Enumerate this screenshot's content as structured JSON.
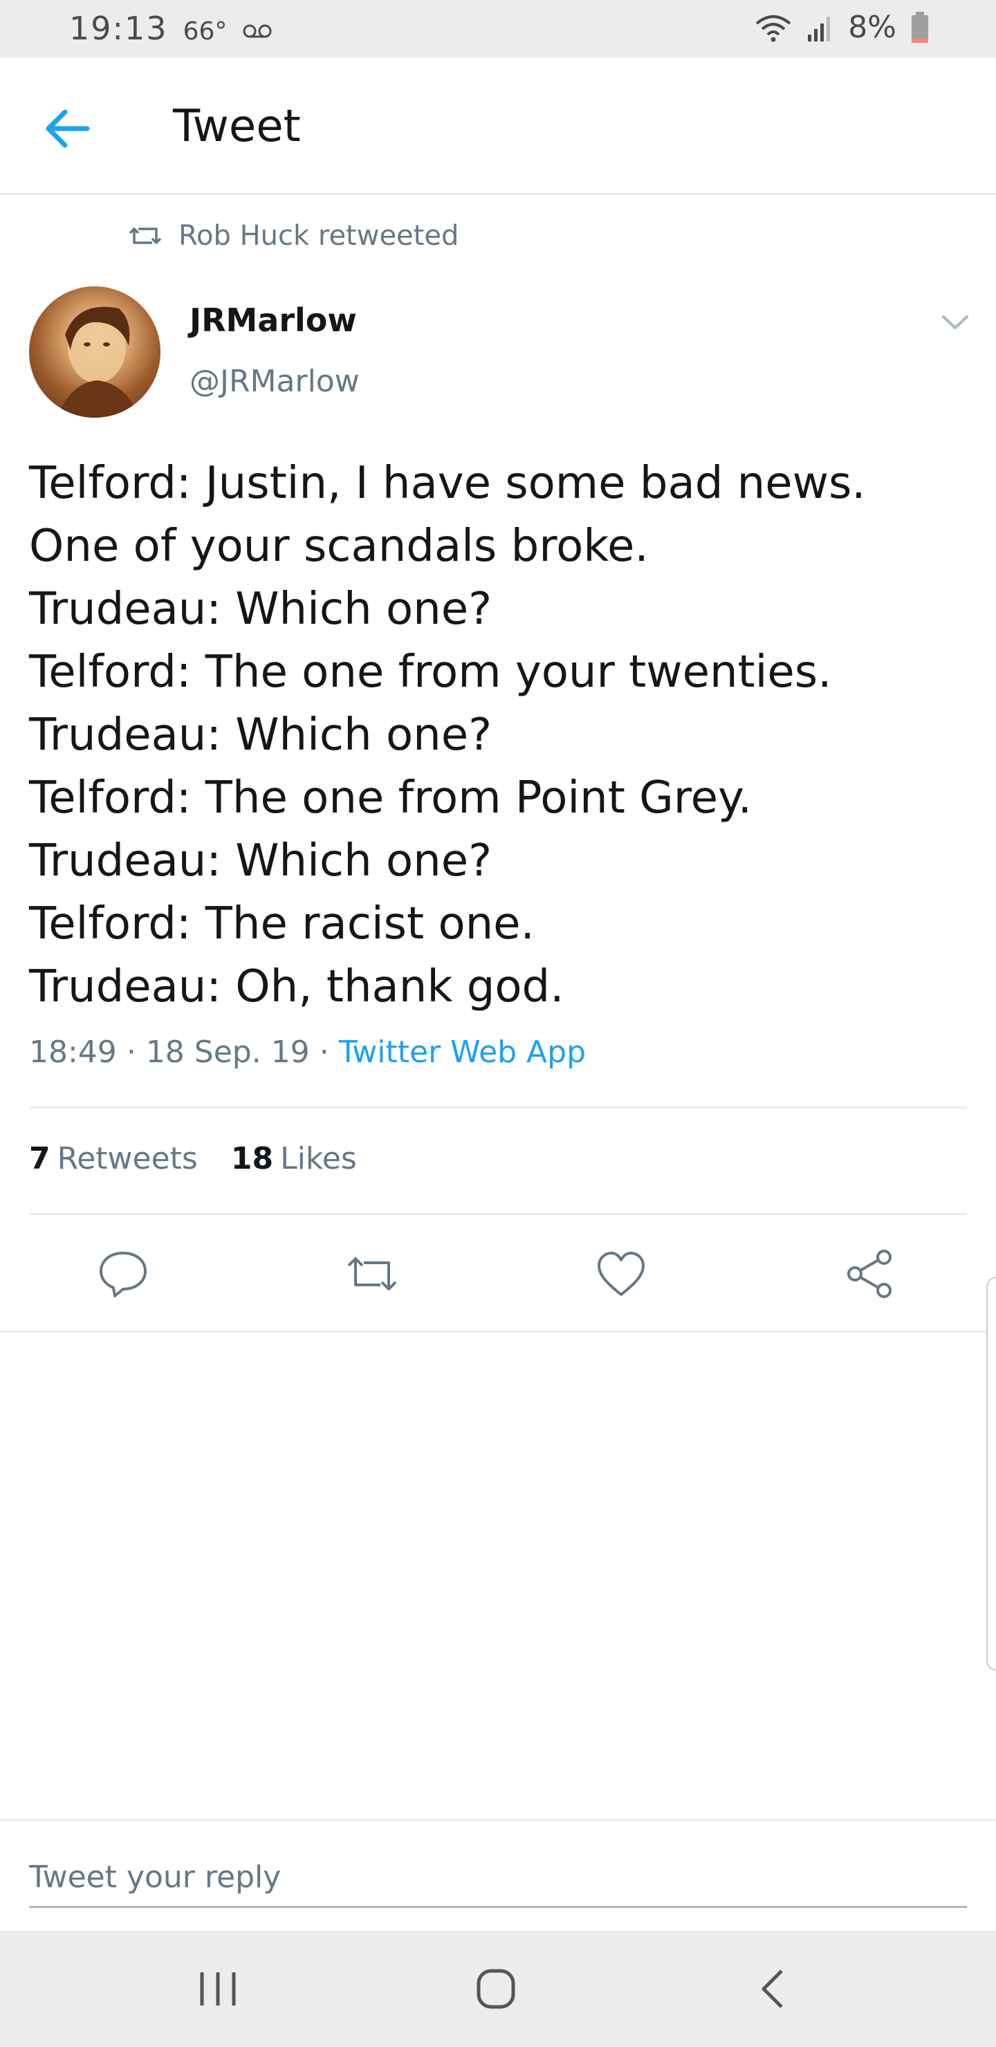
{
  "status_bar": {
    "time": "19:13",
    "temperature": "66°",
    "battery": "8%",
    "icons": [
      "voicemail-icon",
      "wifi-icon",
      "signal-icon",
      "battery-icon"
    ]
  },
  "header": {
    "title": "Tweet",
    "back_icon": "arrow-left-icon"
  },
  "tweet": {
    "retweeted_by": "Rob Huck retweeted",
    "display_name": "JRMarlow",
    "handle": "@JRMarlow",
    "lines": [
      "Telford: Justin, I have some bad news.",
      "One of your scandals broke.",
      "Trudeau: Which one?",
      "Telford: The one from your twenties.",
      "Trudeau: Which one?",
      "Telford: The one from Point Grey.",
      "Trudeau: Which one?",
      "Telford: The racist one.",
      "Trudeau: Oh, thank god."
    ],
    "time": "18:49",
    "date": "18 Sep. 19",
    "separator": "·",
    "source": "Twitter Web App",
    "retweet_count": "7",
    "retweet_label": "Retweets",
    "like_count": "18",
    "like_label": "Likes"
  },
  "actions": [
    "reply-icon",
    "retweet-icon",
    "like-icon",
    "share-icon"
  ],
  "reply": {
    "placeholder": "Tweet your reply"
  },
  "nav": [
    "recent-apps-icon",
    "home-icon",
    "back-icon"
  ],
  "colors": {
    "accent": "#1da1f2",
    "secondary_text": "#657786",
    "divider": "#e6ecf0"
  }
}
